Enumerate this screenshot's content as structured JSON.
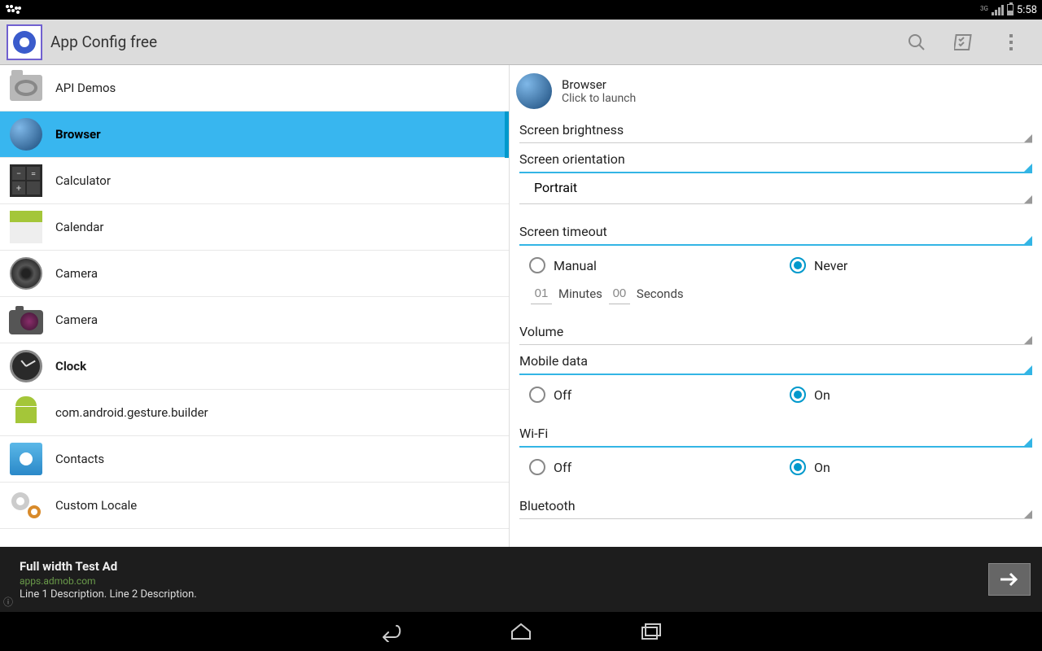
{
  "status": {
    "net": "3G",
    "time": "5:58"
  },
  "actionBar": {
    "title": "App Config free"
  },
  "apps": [
    {
      "name": "API Demos",
      "bold": false
    },
    {
      "name": "Browser",
      "bold": true,
      "selected": true
    },
    {
      "name": "Calculator",
      "bold": false
    },
    {
      "name": "Calendar",
      "bold": false
    },
    {
      "name": "Camera",
      "bold": false
    },
    {
      "name": "Camera",
      "bold": false
    },
    {
      "name": "Clock",
      "bold": true
    },
    {
      "name": "com.android.gesture.builder",
      "bold": false
    },
    {
      "name": "Contacts",
      "bold": false
    },
    {
      "name": "Custom Locale",
      "bold": false
    }
  ],
  "detail": {
    "appName": "Browser",
    "subtitle": "Click to launch",
    "sections": {
      "brightness": {
        "label": "Screen brightness"
      },
      "orientation": {
        "label": "Screen orientation",
        "value": "Portrait"
      },
      "timeout": {
        "label": "Screen timeout",
        "optManual": "Manual",
        "optNever": "Never",
        "minutes": "01",
        "minLabel": "Minutes",
        "seconds": "00",
        "secLabel": "Seconds"
      },
      "volume": {
        "label": "Volume"
      },
      "mobileData": {
        "label": "Mobile data",
        "optOff": "Off",
        "optOn": "On"
      },
      "wifi": {
        "label": "Wi-Fi",
        "optOff": "Off",
        "optOn": "On"
      },
      "bluetooth": {
        "label": "Bluetooth"
      }
    }
  },
  "ad": {
    "title": "Full width Test Ad",
    "url": "apps.admob.com",
    "desc": "Line 1 Description. Line 2 Description."
  }
}
